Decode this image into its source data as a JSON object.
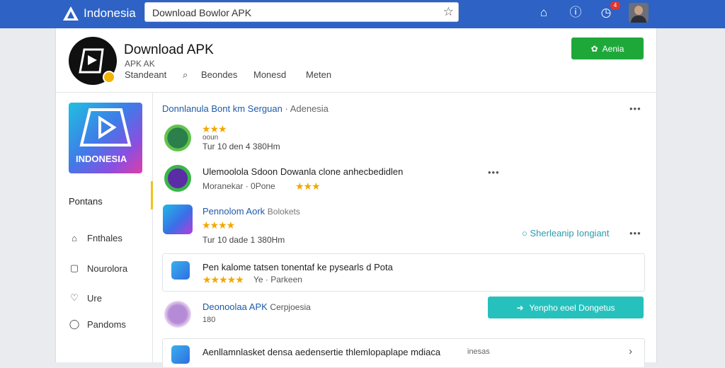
{
  "topbar": {
    "brand": "Indonesia",
    "search_value": "Download Bowlor APK",
    "badge_count": "4",
    "icons": [
      "home-icon",
      "info-icon",
      "timer-icon",
      "user-avatar"
    ]
  },
  "header": {
    "title": "Download APK",
    "subtitle": "APK AK",
    "nav": [
      "Standeant",
      "Beondes",
      "Monesd",
      "Meten"
    ],
    "action_button": "Aenia"
  },
  "sidebar": {
    "logo_text": "INDONESIA",
    "heading": "Pontans",
    "items": [
      "Fnthales",
      "Nourolora",
      "Ure",
      "Pandoms"
    ]
  },
  "main": {
    "section_title": "Donnlanula Bont km Serguan",
    "section_sub": "Adenesia",
    "rows": [
      {
        "line1": "ooun",
        "line2": "Tur 10 den 4 380Hm",
        "rating": "★★★"
      },
      {
        "title": "Ulemoolola Sdoon Dowanla clone anhecbedidlen",
        "meta": "Moranekar · 0Pone",
        "rating": "★★★"
      },
      {
        "title": "Pennolom Aork",
        "title_suffix": "Bolokets",
        "meta": "Tur 10 dade 1 380Hm",
        "rating": "★★★★",
        "link": "Sherleanip Iongiant"
      },
      {
        "title": "Pen kalome tatsen tonentaf ke pysearls d Pota",
        "rating": "★★★★★",
        "meta": "Ye · Parkeen"
      },
      {
        "title": "Deonoolaa APK",
        "title_suffix": "Cerpjoesia",
        "meta": "180",
        "button": "Yenpho eoel Dongetus"
      },
      {
        "title": "Aenllamnlasket densa aedensertie thlemlopaplape mdiaca",
        "suffix": "inesas"
      }
    ]
  },
  "colors": {
    "topbar": "#2e62c4",
    "green_button": "#1fa83a",
    "teal_button": "#27c1bd",
    "star": "#f2a700",
    "link": "#2a9bb0"
  }
}
